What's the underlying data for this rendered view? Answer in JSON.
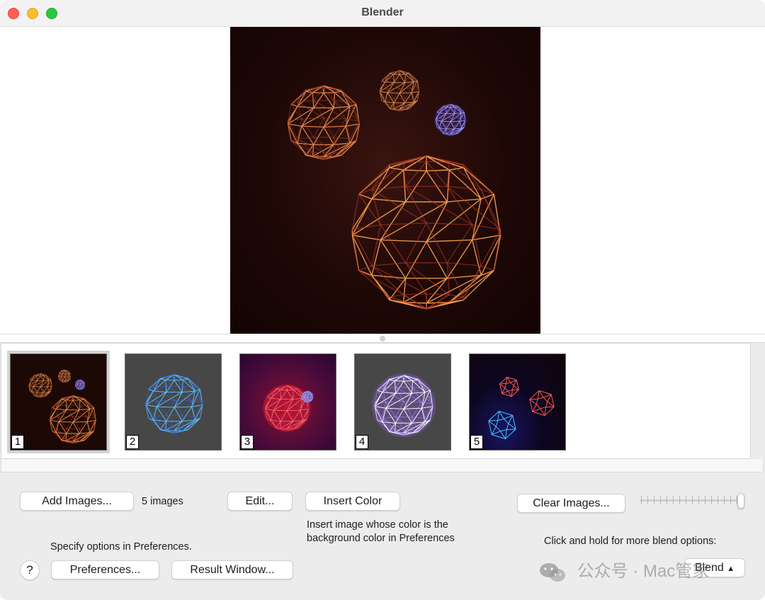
{
  "window": {
    "title": "Blender"
  },
  "colors": {
    "close": "#fe5f57",
    "minimize": "#febc2e",
    "maximize": "#28c840",
    "preview_bg": "#1e0806",
    "thumb_gray_bg": "#474747"
  },
  "thumbnails": [
    {
      "number": "1",
      "selected": true,
      "icon": "orange-wireframe-spheres"
    },
    {
      "number": "2",
      "selected": false,
      "icon": "blue-wireframe-sphere"
    },
    {
      "number": "3",
      "selected": false,
      "icon": "red-wireframe-sphere"
    },
    {
      "number": "4",
      "selected": false,
      "icon": "purple-white-sphere"
    },
    {
      "number": "5",
      "selected": false,
      "icon": "red-blue-polyhedra"
    }
  ],
  "controls": {
    "add_images": "Add Images...",
    "image_count": "5 images",
    "edit": "Edit...",
    "insert_color": "Insert Color",
    "insert_color_hint_line1": "Insert image whose color is the",
    "insert_color_hint_line2": "background color in Preferences",
    "clear_images": "Clear Images...",
    "slider_value": 1.0,
    "specify_options": "Specify options in Preferences.",
    "help": "?",
    "preferences": "Preferences...",
    "result_window": "Result Window...",
    "blend_hint": "Click and hold for more blend options:",
    "blend": "Blend"
  },
  "watermark": {
    "text": "公众号 · Mac管家",
    "icon": "wechat-icon"
  }
}
